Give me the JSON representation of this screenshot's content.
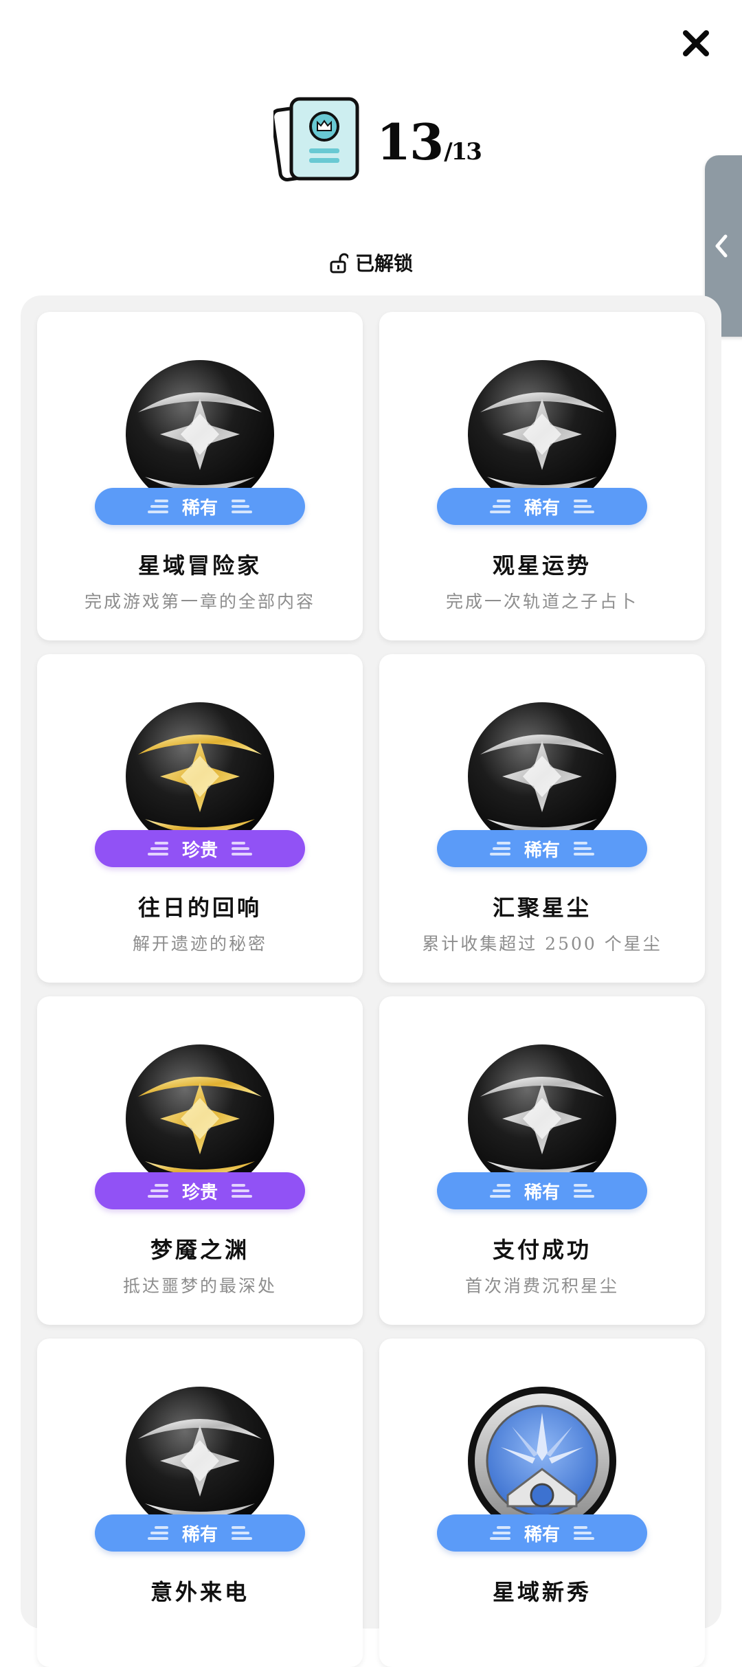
{
  "header": {
    "count": "13",
    "total": "/13",
    "unlocked_label": "已解锁"
  },
  "achievements": [
    {
      "rarity": "稀有",
      "title": "星域冒险家",
      "description": "完成游戏第一章的全部内容",
      "medal": "silver-star-medal"
    },
    {
      "rarity": "稀有",
      "title": "观星运势",
      "description": "完成一次轨道之子占卜",
      "medal": "silver-star-medal"
    },
    {
      "rarity": "珍贵",
      "title": "往日的回响",
      "description": "解开遗迹的秘密",
      "medal": "gold-star-medal"
    },
    {
      "rarity": "稀有",
      "title": "汇聚星尘",
      "description": "累计收集超过 2500 个星尘",
      "medal": "silver-star-medal"
    },
    {
      "rarity": "珍贵",
      "title": "梦魇之渊",
      "description": "抵达噩梦的最深处",
      "medal": "gold-star-medal"
    },
    {
      "rarity": "稀有",
      "title": "支付成功",
      "description": "首次消费沉积星尘",
      "medal": "silver-star-medal"
    },
    {
      "rarity": "稀有",
      "title": "意外来电",
      "description": "",
      "medal": "silver-star-medal"
    },
    {
      "rarity": "稀有",
      "title": "星域新秀",
      "description": "",
      "medal": "blue-compass-medal"
    }
  ],
  "colors": {
    "rare_pill": "#5b9bf8",
    "epic_pill": "#9152f5",
    "panel_bg": "#f2f2f2",
    "side_tab": "#8e9aa3"
  }
}
